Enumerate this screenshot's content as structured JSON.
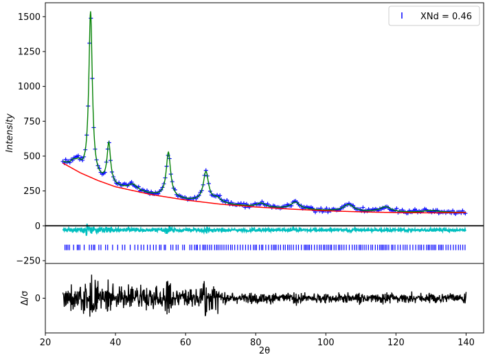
{
  "chart_data": [
    {
      "panel": "main",
      "type": "line",
      "ylabel": "Intensity",
      "xlim": [
        20,
        145
      ],
      "ylim": [
        -270,
        1600
      ],
      "xticks": [
        20,
        40,
        60,
        80,
        100,
        120,
        140
      ],
      "yticks": [
        -250,
        0,
        250,
        500,
        750,
        1000,
        1250,
        1500
      ],
      "ytick_labels": [
        "−250",
        "0",
        "250",
        "500",
        "750",
        "1000",
        "1250",
        "1500"
      ],
      "zero_line": true,
      "grid": false,
      "legend": {
        "placement": "top-right",
        "label": "XNd = 0.46",
        "marker": "|",
        "color": "#0000ff"
      },
      "colors": {
        "observed": "#0000ff",
        "calculated": "#008000",
        "background": "#ff0000",
        "difference": "#00bfbf",
        "reflections": "#0000ff",
        "zero_line": "#000000"
      },
      "peaks": [
        {
          "x": 28.0,
          "height": 40,
          "width": 1.0
        },
        {
          "x": 29.5,
          "height": 50,
          "width": 1.0
        },
        {
          "x": 32.9,
          "height": 1180,
          "width": 0.6
        },
        {
          "x": 38.1,
          "height": 285,
          "width": 0.6
        },
        {
          "x": 45.0,
          "height": 40,
          "width": 1.5
        },
        {
          "x": 55.1,
          "height": 320,
          "width": 0.75
        },
        {
          "x": 65.8,
          "height": 215,
          "width": 0.9
        },
        {
          "x": 69.0,
          "height": 35,
          "width": 1.5
        },
        {
          "x": 81.5,
          "height": 28,
          "width": 1.5
        },
        {
          "x": 91.3,
          "height": 50,
          "width": 1.6
        },
        {
          "x": 106.5,
          "height": 48,
          "width": 1.8
        },
        {
          "x": 117.0,
          "height": 38,
          "width": 2.0
        },
        {
          "x": 130.0,
          "height": 15,
          "width": 3.0
        }
      ],
      "background_points": [
        {
          "x": 25,
          "y": 450
        },
        {
          "x": 30,
          "y": 380
        },
        {
          "x": 35,
          "y": 325
        },
        {
          "x": 40,
          "y": 280
        },
        {
          "x": 50,
          "y": 225
        },
        {
          "x": 60,
          "y": 185
        },
        {
          "x": 70,
          "y": 155
        },
        {
          "x": 80,
          "y": 135
        },
        {
          "x": 90,
          "y": 120
        },
        {
          "x": 100,
          "y": 108
        },
        {
          "x": 110,
          "y": 100
        },
        {
          "x": 120,
          "y": 95
        },
        {
          "x": 130,
          "y": 93
        },
        {
          "x": 140,
          "y": 95
        }
      ],
      "difference_offset": -30,
      "reflection_row_y": -155,
      "reflection_range": [
        25,
        140
      ],
      "x_range": [
        25,
        140
      ]
    },
    {
      "panel": "residual",
      "type": "line",
      "xlabel": "2θ",
      "ylabel": "Δ/σ",
      "xlim": [
        20,
        145
      ],
      "ylim": [
        -4,
        4
      ],
      "xticks": [
        20,
        40,
        60,
        80,
        100,
        120,
        140
      ],
      "yticks": [
        0
      ],
      "color": "#000000",
      "x_range": [
        25,
        140
      ],
      "amplitude_notes": "large excursions near 33, 38 and 55, 66 degrees; quieter above 70"
    }
  ]
}
